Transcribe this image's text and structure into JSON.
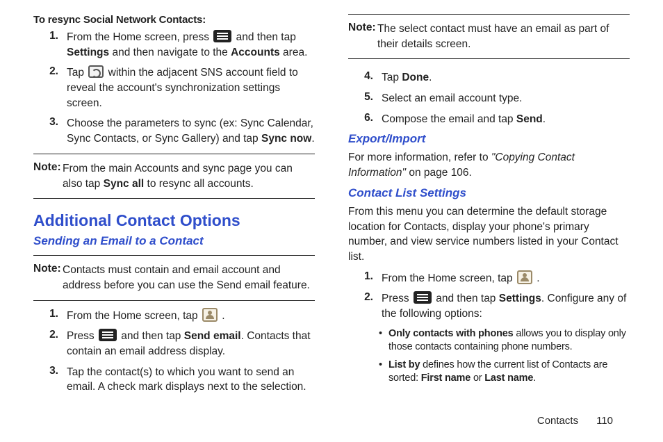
{
  "left": {
    "resync_heading": "To resync Social Network Contacts:",
    "steps_a": [
      {
        "num": "1.",
        "pre": "From the Home screen, press",
        "icon": "menu",
        "post1": " and then tap ",
        "b1": "Settings",
        "post2": " and then navigate to the ",
        "b2": "Accounts",
        "post3": " area."
      },
      {
        "num": "2.",
        "pre": "Tap ",
        "icon": "sync",
        "post1": " within the adjacent SNS account field to reveal the account's synchronization settings screen."
      },
      {
        "num": "3.",
        "pre": "Choose the parameters to sync (ex: Sync Calendar, Sync Contacts, or Sync Gallery) and tap ",
        "b1": "Sync now",
        "post1": "."
      }
    ],
    "note1_label": "Note:",
    "note1_text_pre": "From the main Accounts and sync page you can also tap ",
    "note1_bold": "Sync all",
    "note1_text_post": " to resync all accounts.",
    "h2": "Additional Contact Options",
    "h3": "Sending an Email to a Contact",
    "note2_label": "Note:",
    "note2_text": "Contacts must contain and email account and address before you can use the Send email feature.",
    "steps_b": [
      {
        "num": "1.",
        "pre": "From the Home screen, tap ",
        "icon": "contacts",
        "post1": " ."
      },
      {
        "num": "2.",
        "pre": "Press ",
        "icon": "menu",
        "post1": " and then tap ",
        "b1": "Send email",
        "post2": ". Contacts that contain an email address display."
      },
      {
        "num": "3.",
        "pre": "Tap the contact(s) to which you want to send an email. A check mark displays next to the selection."
      }
    ]
  },
  "right": {
    "note3_label": "Note:",
    "note3_text": "The select contact must have an email as part of their details screen.",
    "steps_c": [
      {
        "num": "4.",
        "pre": "Tap ",
        "b1": "Done",
        "post1": "."
      },
      {
        "num": "5.",
        "pre": "Select an email account type."
      },
      {
        "num": "6.",
        "pre": "Compose the email and tap ",
        "b1": "Send",
        "post1": "."
      }
    ],
    "h3a": "Export/Import",
    "export_text_pre": "For more information, refer to ",
    "export_text_it": "\"Copying Contact Information\"",
    "export_text_post": " on page 106.",
    "h3b": "Contact List Settings",
    "cls_text": "From this menu you can determine the default storage location for Contacts, display your phone's primary number, and view service numbers listed in your Contact list.",
    "steps_d": [
      {
        "num": "1.",
        "pre": "From the Home screen, tap ",
        "icon": "contacts",
        "post1": " ."
      },
      {
        "num": "2.",
        "pre": "Press ",
        "icon": "menu",
        "post1": " and then tap ",
        "b1": "Settings",
        "post2": ". Configure any of the following options:"
      }
    ],
    "bullets": [
      {
        "b": "Only contacts with phones",
        "t": " allows you to display only those contacts containing phone numbers."
      },
      {
        "b": "List by",
        "t": " defines how the current list of Contacts are sorted: ",
        "b2": "First name",
        "t2": " or ",
        "b3": "Last name",
        "t3": "."
      }
    ]
  },
  "footer": {
    "section": "Contacts",
    "page": "110"
  }
}
